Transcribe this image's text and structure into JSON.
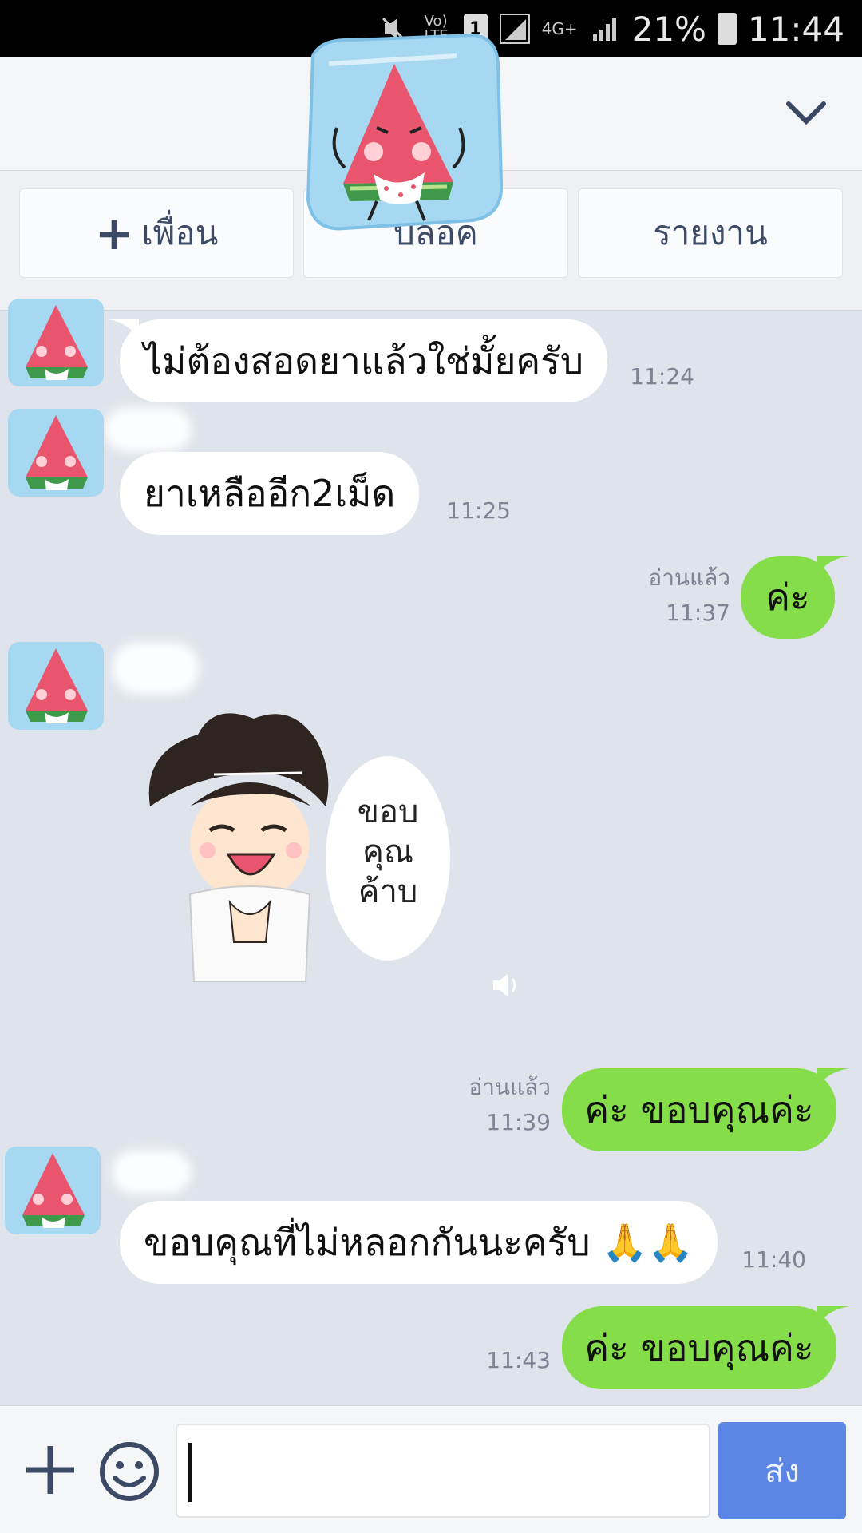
{
  "status_bar": {
    "sim": "1",
    "network": "4G+",
    "battery": "21%",
    "time": "11:44"
  },
  "actions": {
    "add_friend": "เพื่อน",
    "block": "บล็อค",
    "report": "รายงาน"
  },
  "messages": [
    {
      "side": "in",
      "text": "ไม่ต้องสอดยาแล้วใช่มั้ยครับ",
      "time": "11:24"
    },
    {
      "side": "in",
      "text": "ยาเหลืออีก2เม็ด",
      "time": "11:25"
    },
    {
      "side": "out",
      "text": "ค่ะ",
      "read": "อ่านแล้ว",
      "time": "11:37"
    },
    {
      "side": "in",
      "type": "sticker",
      "sticker_text": [
        "ขอบ",
        "คุณ",
        "ค้าบ"
      ]
    },
    {
      "side": "out",
      "text": "ค่ะ ขอบคุณค่ะ",
      "read": "อ่านแล้ว",
      "time": "11:39"
    },
    {
      "side": "in",
      "text": "ขอบคุณที่ไม่หลอกกันนะครับ 🙏🙏",
      "time": "11:40"
    },
    {
      "side": "out",
      "text": "ค่ะ ขอบคุณค่ะ",
      "time": "11:43"
    }
  ],
  "input": {
    "send_label": "ส่ง"
  }
}
